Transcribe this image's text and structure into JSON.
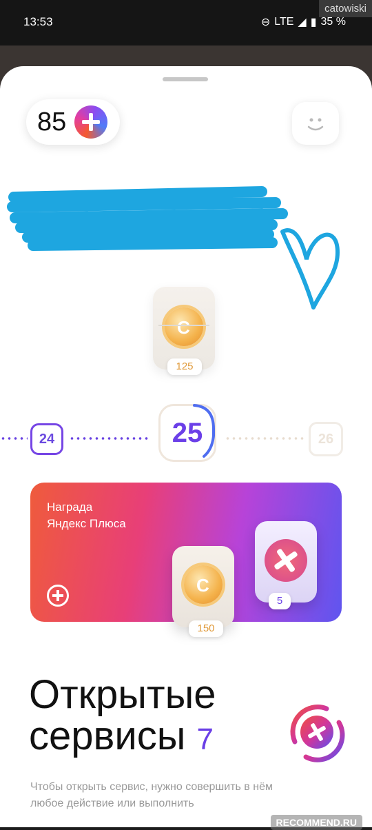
{
  "status_bar": {
    "time": "13:53",
    "network": "LTE",
    "battery": "35 %"
  },
  "watermark_top": "catowiski",
  "header": {
    "plus_balance": "85"
  },
  "current_chest": {
    "coins": "125"
  },
  "levels": {
    "previous": "24",
    "current": "25",
    "next": "26"
  },
  "reward_card": {
    "title": "Награда\nЯндекс Плюса",
    "coins": "150",
    "plus_points": "5"
  },
  "services": {
    "title_line1": "Открытые",
    "title_line2": "сервисы",
    "count": "7",
    "description": "Чтобы открыть сервис, нужно совершить в нём любое действие или выполнить"
  },
  "watermark_bottom": "RECOMMEND.RU",
  "colors": {
    "accent": "#6a3fe6",
    "scribble": "#1ea6e0"
  }
}
